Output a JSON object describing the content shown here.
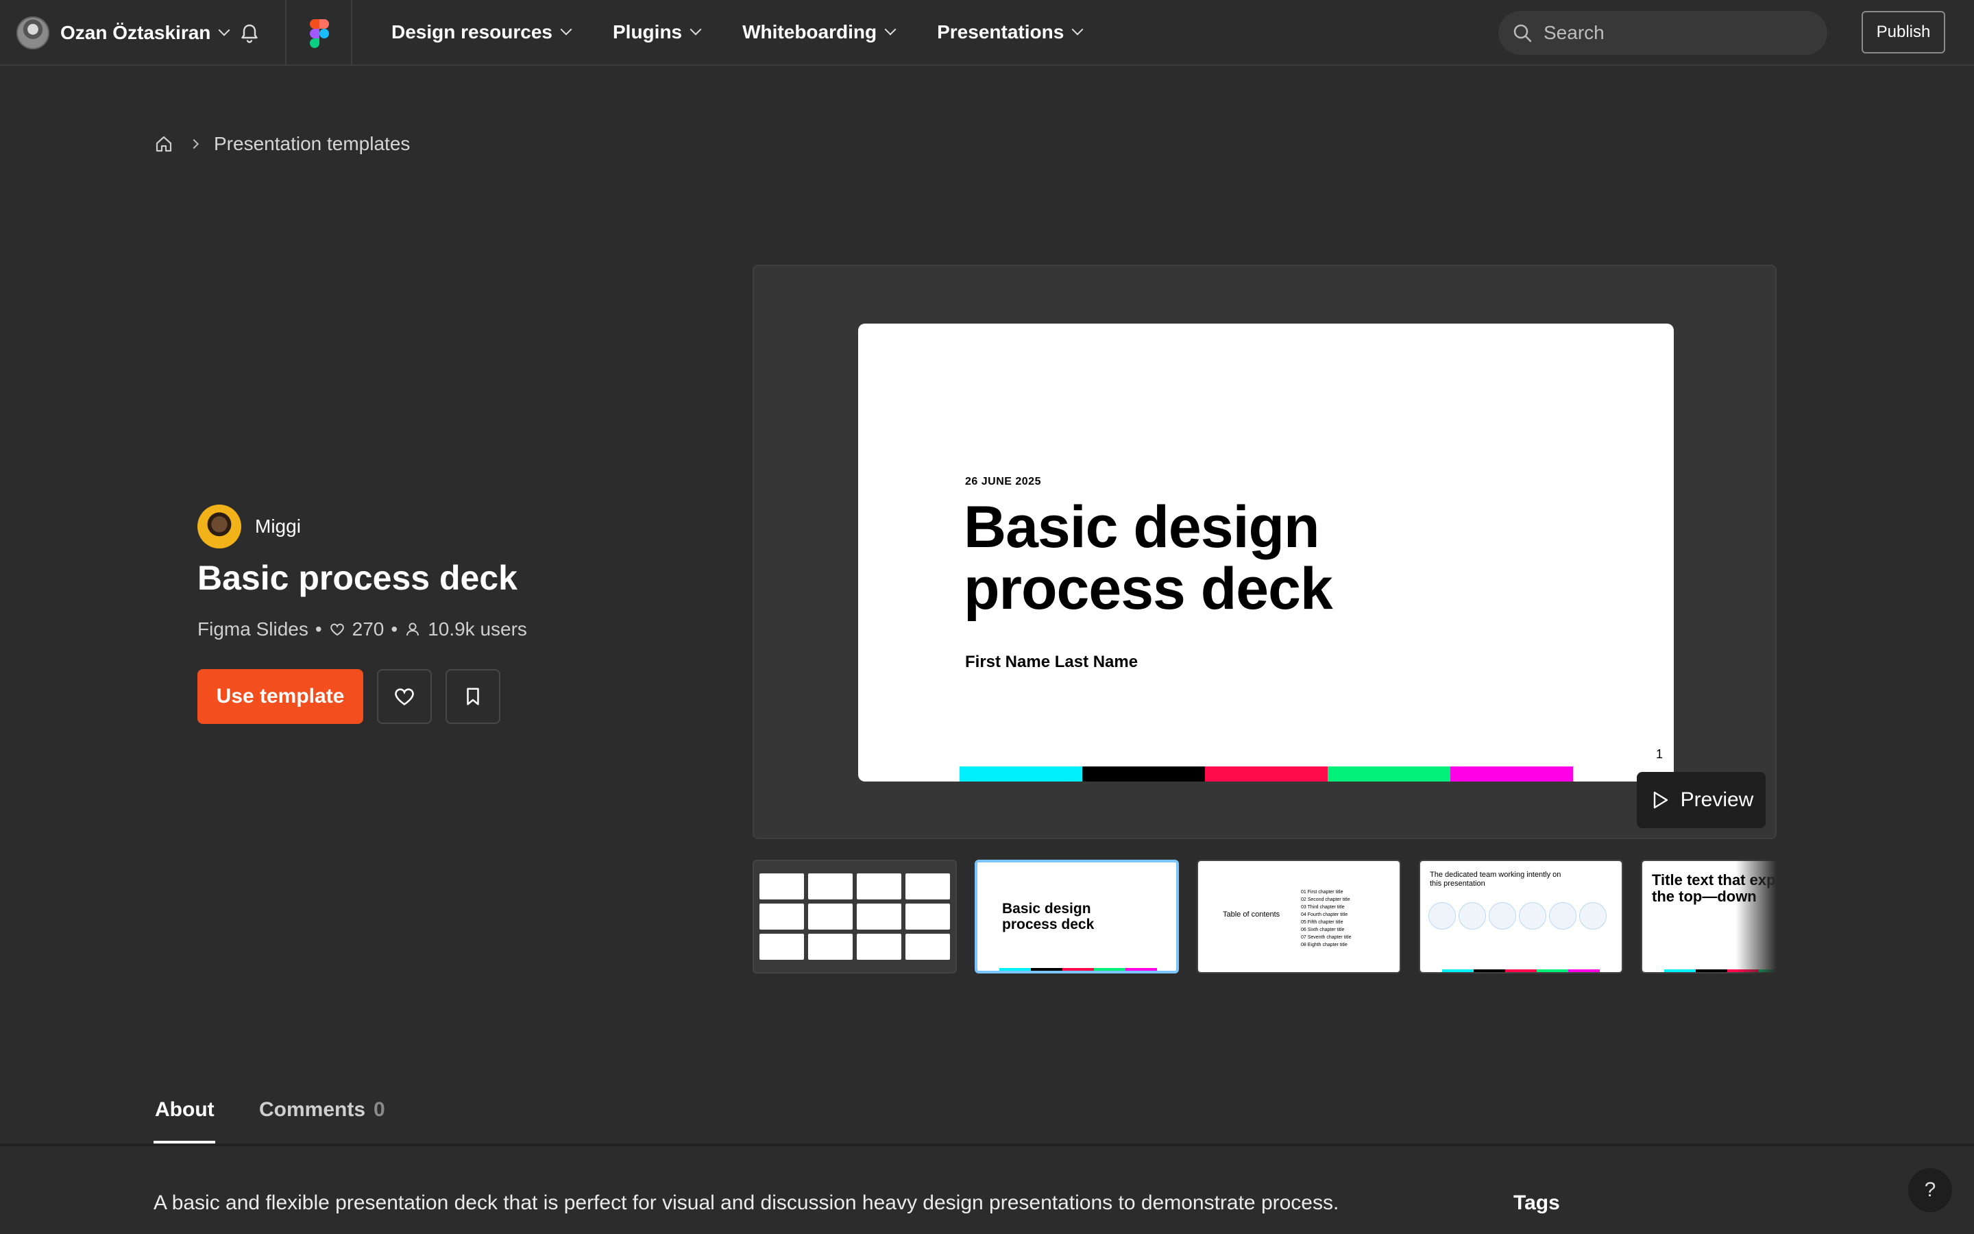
{
  "header": {
    "user_name": "Ozan Öztaskiran",
    "nav": [
      "Design resources",
      "Plugins",
      "Whiteboarding",
      "Presentations"
    ],
    "search_placeholder": "Search",
    "publish_label": "Publish"
  },
  "breadcrumb": {
    "current": "Presentation templates"
  },
  "resource": {
    "author": "Miggi",
    "title": "Basic process deck",
    "type": "Figma Slides",
    "likes": "270",
    "users": "10.9k users",
    "use_label": "Use template"
  },
  "slide": {
    "date": "26 JUNE 2025",
    "title": "Basic design\nprocess deck",
    "name": "First Name Last Name",
    "page": "1",
    "bar_colors": [
      "#00f0ff",
      "#000000",
      "#ff0a4c",
      "#00f07a",
      "#ff00e6"
    ]
  },
  "preview_label": "Preview",
  "thumbnails": [
    {
      "kind": "grid"
    },
    {
      "kind": "title",
      "title": "Basic design\nprocess deck"
    },
    {
      "kind": "toc",
      "title": "Table of contents",
      "items": [
        "01 First chapter title",
        "02 Second chapter title",
        "03 Third chapter title",
        "04 Fourth chapter title",
        "05 Fifth chapter title",
        "06 Sixth chapter title",
        "07 Seventh chapter title",
        "08 Eighth chapter title"
      ]
    },
    {
      "kind": "team",
      "title": "The dedicated team working intently on this presentation"
    },
    {
      "kind": "text",
      "title": "Title text that explains from the top—down"
    }
  ],
  "tabs": {
    "about": "About",
    "comments": "Comments",
    "comments_count": "0"
  },
  "about_text": "A basic and flexible presentation deck that is perfect for visual and discussion heavy design presentations to demonstrate process.",
  "tags_title": "Tags",
  "help_label": "?"
}
